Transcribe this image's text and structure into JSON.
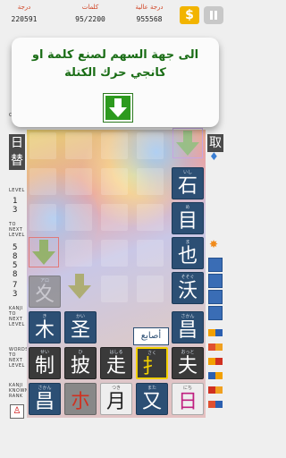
{
  "scores": [
    {
      "label": "درجة",
      "value": "220591"
    },
    {
      "label": "كلمات",
      "value": "95/2200"
    },
    {
      "label": "درجة عالية",
      "value": "955568"
    }
  ],
  "coin_symbol": "$",
  "instruction": "الى جهة السهم لصنع كلمة او كانجي حرك الكتلة",
  "side": {
    "left_kanji_1": "日",
    "left_kanji_2": "替",
    "right_kanji": "取",
    "left_small_1": "CLEAR",
    "left_small_2": "LEVEL",
    "level_label": "LEVEL",
    "level_value": "13",
    "next_label": "TO NEXT LEVEL",
    "next_value": "5858",
    "next_value2": "73",
    "kanji_label": "KANJI TO NEXT LEVEL",
    "words_label": "WORDS TO NEXT LEVEL",
    "kanji_known_label": "KANJI KNOWN RANK"
  },
  "tooltip": "أصابع",
  "tiles": [
    {
      "kana": "いし",
      "kanji": "石"
    },
    {
      "kana": "め",
      "kanji": "目"
    },
    {
      "kana": "ま",
      "kanji": "也"
    },
    {
      "kana": "そそぐ",
      "kanji": "沃"
    },
    {
      "kana": "アロ",
      "kanji": "夊"
    },
    {
      "kana": "き",
      "kanji": "木"
    },
    {
      "kana": "かい",
      "kanji": "圣"
    },
    {
      "kana": "さかん",
      "kanji": "昌"
    },
    {
      "kana": "せい",
      "kanji": "制"
    },
    {
      "kana": "ひ",
      "kanji": "披"
    },
    {
      "kana": "はしる",
      "kanji": "走"
    },
    {
      "kana": "さく",
      "kanji": "扌"
    },
    {
      "kana": "おっと",
      "kanji": "夫"
    },
    {
      "kana": "さかん",
      "kanji": "昌"
    },
    {
      "kana": "",
      "kanji": "朩"
    },
    {
      "kana": "つき",
      "kanji": "月"
    },
    {
      "kana": "また",
      "kanji": "又"
    },
    {
      "kana": "にち",
      "kanji": "日"
    }
  ]
}
